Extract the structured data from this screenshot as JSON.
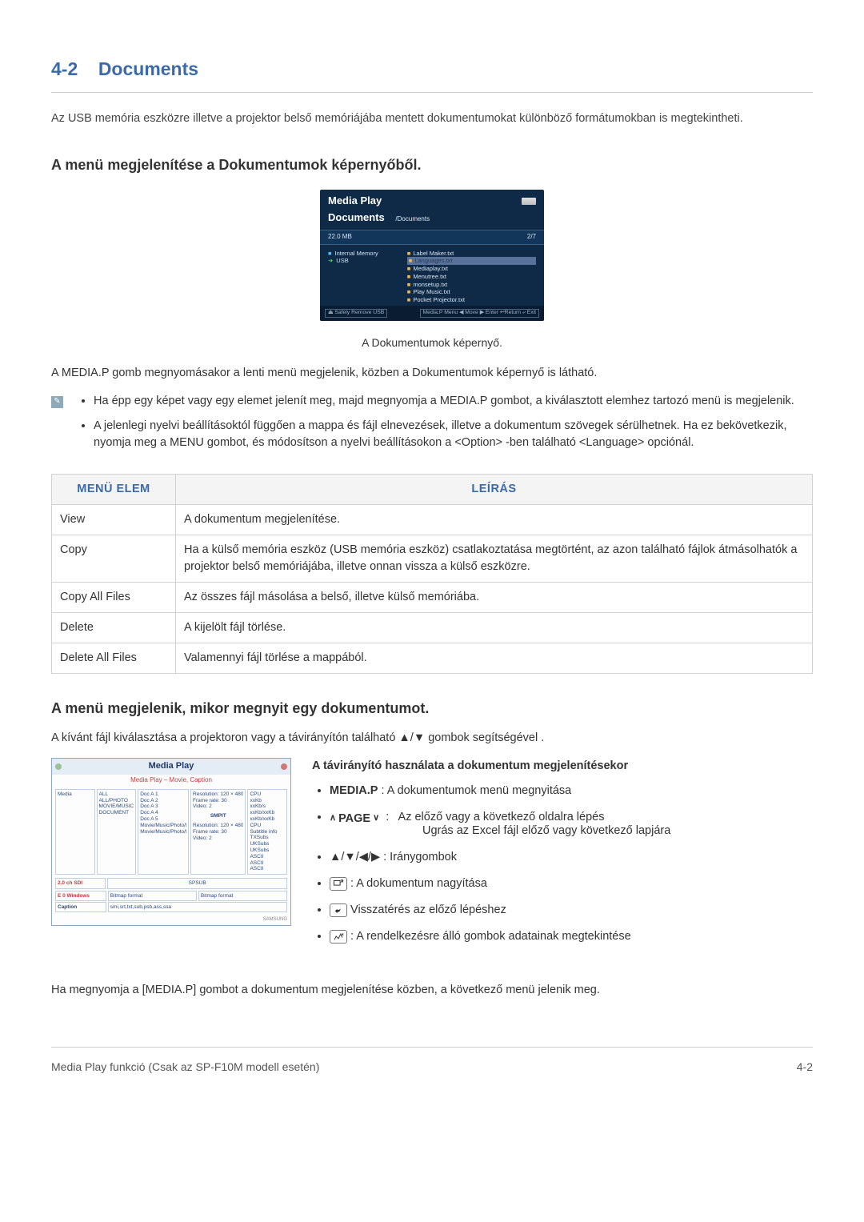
{
  "section_num": "4-2",
  "section_title": "Documents",
  "intro": "Az USB memória eszközre illetve a projektor belső memóriájába mentett dokumentumokat különböző formátumokban is megtekintheti.",
  "sub1": "A menü megjelenítése a Dokumentumok képernyőből.",
  "screenshot1": {
    "brand": "Media Play",
    "title": "Documents",
    "path": "/Documents",
    "size": "22.0 MB",
    "count": "2/7",
    "left_internal": "Internal Memory",
    "left_usb": "USB",
    "files": [
      "Label Maker.txt",
      "Languages.txt",
      "Mediaplay.txt",
      "Menutree.txt",
      "monsetup.txt",
      "Play Music.txt",
      "Pocket Projector.txt"
    ],
    "selected_index": 1,
    "foot_left": "Safely Remove USB",
    "foot_right": "Media.P Menu ◀ Move ▶ Enter ↩Return ⤶ Exit"
  },
  "caption1": "A Dokumentumok képernyő.",
  "after_caption": "A MEDIA.P gomb megnyomásakor a lenti menü megjelenik, közben a Dokumentumok képernyő is látható.",
  "note_bullets": [
    "Ha épp egy képet vagy egy elemet jelenít meg, majd megnyomja a MEDIA.P gombot, a kiválasztott elemhez tartozó menü is megjelenik.",
    "A jelenlegi nyelvi beállításoktól függően a mappa és fájl elnevezések, illetve a dokumentum szövegek sérülhetnek. Ha ez bekövetkezik, nyomja meg a MENU gombot, és módosítson a nyelvi beállításokon a <Option> -ben található <Language> opciónál."
  ],
  "table": {
    "head_menu": "MENÜ ELEM",
    "head_desc": "LEÍRÁS",
    "rows": [
      {
        "m": "View",
        "d": "A dokumentum megjelenítése."
      },
      {
        "m": "Copy",
        "d": "Ha a külső memória eszköz (USB memória eszköz) csatlakoztatása megtörtént, az azon található fájlok átmásolhatók a projektor belső memóriájába, illetve onnan vissza a külső eszközre."
      },
      {
        "m": "Copy All Files",
        "d": "Az összes fájl másolása a belső, illetve külső memóriába."
      },
      {
        "m": "Delete",
        "d": "A kijelölt fájl törlése."
      },
      {
        "m": "Delete All Files",
        "d": "Valamennyi fájl törlése a mappából."
      }
    ]
  },
  "sub2": "A menü megjelenik, mikor megnyit egy dokumentumot.",
  "sub2_para": "A kívánt fájl kiválasztása a projektoron vagy a távirányítón található ▲/▼ gombok segítségével .",
  "screenshot2": {
    "brand": "Media Play",
    "subtitle": "Media Play – Movie, Caption",
    "col1_label": "Media",
    "col2_lines": [
      "ALL",
      "ALL/PHOTO",
      "MOVIE/MUSIC",
      "DOCUMENT"
    ],
    "col3_lines": [
      "Doc A 1",
      "Doc A 2",
      "Doc A 3",
      "Doc A 4",
      "Doc A 5",
      "Movie/Music/Photo/Doc",
      "Movie/Music/Photo/Doc"
    ],
    "col4_lines_a": [
      "Resolution: 120 × 480",
      "Frame rate: 30",
      "Video: 2"
    ],
    "col4_mid": "SMPIT",
    "col4_lines_b": [
      "Resolution: 120 × 480",
      "Frame rate: 30",
      "Video: 2"
    ],
    "col5_lines": [
      "CPU",
      "xxKb",
      "xxKb/s",
      "xxKb/xxKb",
      "xxKb/xxKb",
      "CPU",
      "Subtitle info",
      "TXSubs",
      "UKSubs",
      "UKSubs",
      "ASCII",
      "ASCII",
      "ASCII"
    ],
    "below_label": "2.0 ch SDI",
    "below_text": "SPSUB",
    "tot1_label": "E 0 Windows",
    "tot1_vals": [
      "Bitmap format",
      "Bitmap format"
    ],
    "tot2_label": "Caption",
    "tot2_vals": [
      "smi,srt,txt,sub,psb,ass,ssa",
      ""
    ],
    "corner": "SAMSUNG"
  },
  "remote": {
    "title": "A távirányító használata a dokumentum megjelenítésekor",
    "items": {
      "media_label": "MEDIA.P",
      "media_text": " : A dokumentumok menü megnyitása",
      "page_label": "PAGE",
      "page_text": "Az előző vagy a következő oldalra lépés",
      "page_text2": "Ugrás az Excel fájl előző vagy következő lapjára",
      "arrows": "▲/▼/◀/▶ : Iránygombok",
      "enlarge": " : A dokumentum nagyítása",
      "return": " Visszatérés az előző lépéshez",
      "info": " : A rendelkezésre álló gombok adatainak megtekintése"
    }
  },
  "closing": "Ha megnyomja a [MEDIA.P] gombot a dokumentum megjelenítése közben, a következő menü jelenik meg.",
  "footer_left": "Media Play funkció (Csak az SP-F10M modell esetén)",
  "footer_right": "4-2"
}
